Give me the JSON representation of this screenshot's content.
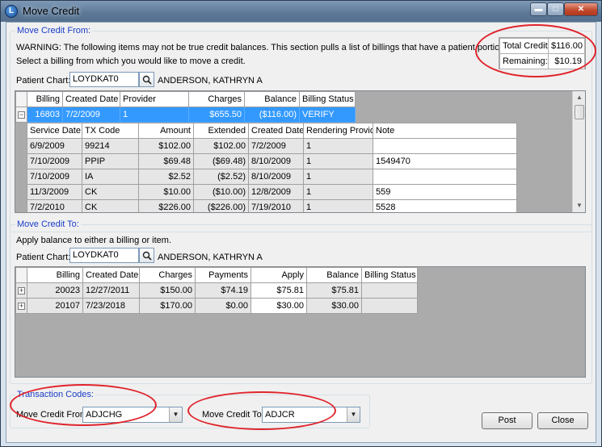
{
  "window": {
    "title": "Move Credit",
    "icon": "app-logo-icon"
  },
  "move_from": {
    "legend": "Move Credit From:",
    "warning": "WARNING: The following items may not be true credit balances.  This section pulls a list of billings that have a patient portion credit balance",
    "instruction": "Select a billing from which you would like to move a credit.",
    "patient_chart_label": "Patient Chart:",
    "patient_chart_value": "LOYDKAT0",
    "patient_name": "ANDERSON, KATHRYN A",
    "credit_summary": {
      "total_label": "Total Credit:",
      "total_value": "$116.00",
      "remaining_label": "Remaining:",
      "remaining_value": "$10.19"
    },
    "billing_headers": {
      "billing": "Billing",
      "created": "Created Date",
      "provider": "Provider",
      "charges": "Charges",
      "balance": "Balance",
      "status": "Billing Status"
    },
    "selected_billing": {
      "billing": "16803",
      "created": "7/2/2009",
      "provider": "1",
      "charges": "$655.50",
      "balance": "($116.00)",
      "status": "VERIFY"
    },
    "item_headers": {
      "service_date": "Service Date",
      "tx_code": "TX Code",
      "amount": "Amount",
      "extended": "Extended",
      "created": "Created Date",
      "provider": "Rendering Provider",
      "note": "Note"
    },
    "items": [
      {
        "service_date": "6/9/2009",
        "tx_code": "99214",
        "amount": "$102.00",
        "extended": "$102.00",
        "created": "7/2/2009",
        "provider": "1",
        "note": ""
      },
      {
        "service_date": "7/10/2009",
        "tx_code": "PPIP",
        "amount": "$69.48",
        "extended": "($69.48)",
        "created": "8/10/2009",
        "provider": "1",
        "note": "1549470"
      },
      {
        "service_date": "7/10/2009",
        "tx_code": "IA",
        "amount": "$2.52",
        "extended": "($2.52)",
        "created": "8/10/2009",
        "provider": "1",
        "note": ""
      },
      {
        "service_date": "11/3/2009",
        "tx_code": "CK",
        "amount": "$10.00",
        "extended": "($10.00)",
        "created": "12/8/2009",
        "provider": "1",
        "note": "559"
      },
      {
        "service_date": "7/2/2010",
        "tx_code": "CK",
        "amount": "$226.00",
        "extended": "($226.00)",
        "created": "7/19/2010",
        "provider": "1",
        "note": "5528"
      }
    ]
  },
  "move_to": {
    "legend": "Move Credit To:",
    "instruction": "Apply balance to either a billing or item.",
    "patient_chart_label": "Patient Chart:",
    "patient_chart_value": "LOYDKAT0",
    "patient_name": "ANDERSON, KATHRYN A",
    "headers": {
      "billing": "Billing",
      "created": "Created Date",
      "charges": "Charges",
      "payments": "Payments",
      "apply": "Apply",
      "balance": "Balance",
      "status": "Billing Status"
    },
    "rows": [
      {
        "billing": "20023",
        "created": "12/27/2011",
        "charges": "$150.00",
        "payments": "$74.19",
        "apply": "$75.81",
        "balance": "$75.81",
        "status": ""
      },
      {
        "billing": "20107",
        "created": "7/23/2018",
        "charges": "$170.00",
        "payments": "$0.00",
        "apply": "$30.00",
        "balance": "$30.00",
        "status": ""
      }
    ]
  },
  "transaction_codes": {
    "legend": "Transaction Codes:",
    "from_label": "Move Credit From:",
    "from_value": "ADJCHG",
    "to_label": "Move Credit To:",
    "to_value": "ADJCR"
  },
  "buttons": {
    "post": "Post",
    "close": "Close"
  },
  "colors": {
    "selection": "#3399ff",
    "legend_text": "#1a3cc9",
    "annotation_ellipse": "#e0242b"
  }
}
